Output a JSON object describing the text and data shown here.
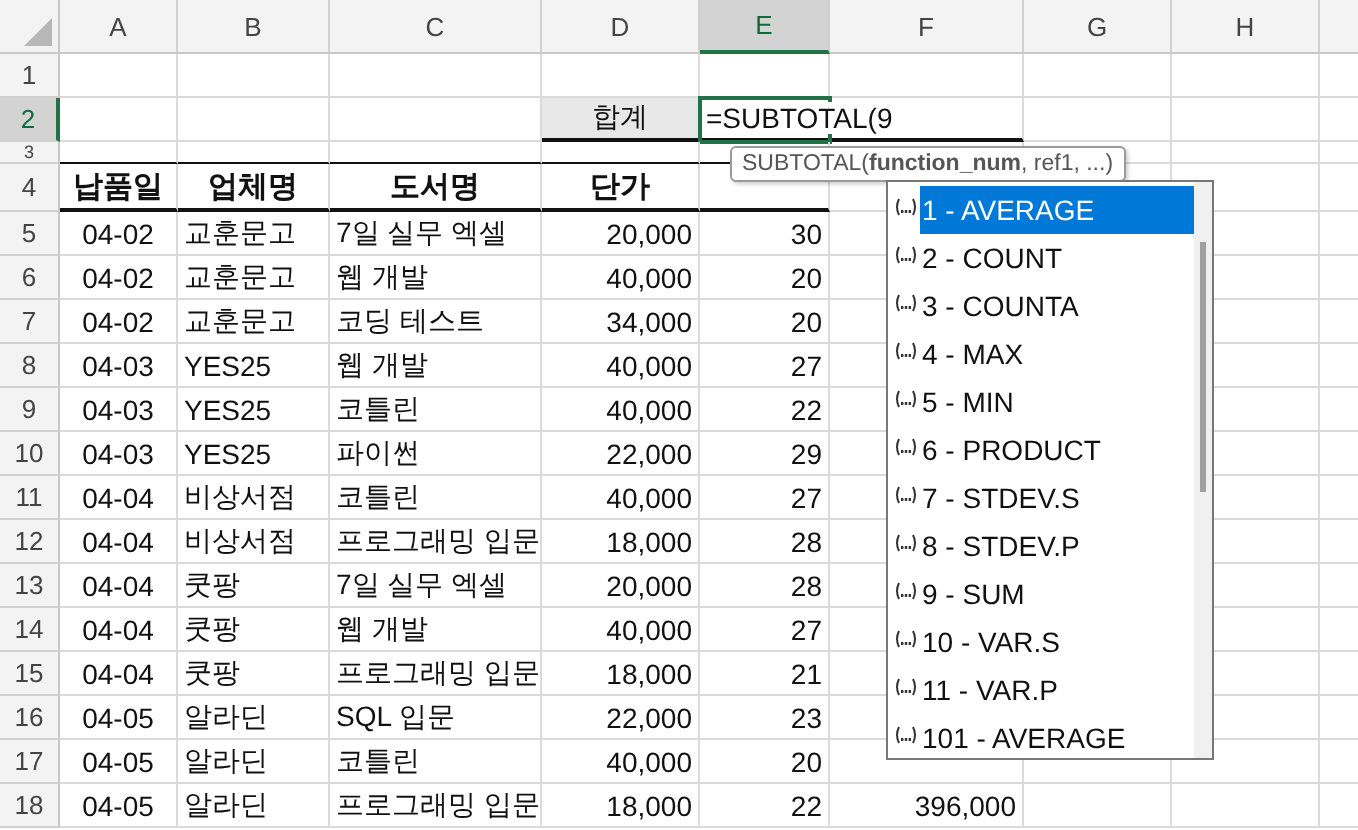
{
  "columns": [
    {
      "label": "A",
      "selected": false
    },
    {
      "label": "B",
      "selected": false
    },
    {
      "label": "C",
      "selected": false
    },
    {
      "label": "D",
      "selected": false
    },
    {
      "label": "E",
      "selected": true
    },
    {
      "label": "F",
      "selected": false
    },
    {
      "label": "G",
      "selected": false
    },
    {
      "label": "H",
      "selected": false
    }
  ],
  "rows": [
    {
      "label": "1",
      "selected": false
    },
    {
      "label": "2",
      "selected": true
    },
    {
      "label": "3",
      "selected": false
    },
    {
      "label": "4",
      "selected": false
    },
    {
      "label": "5",
      "selected": false
    },
    {
      "label": "6",
      "selected": false
    },
    {
      "label": "7",
      "selected": false
    },
    {
      "label": "8",
      "selected": false
    },
    {
      "label": "9",
      "selected": false
    },
    {
      "label": "10",
      "selected": false
    },
    {
      "label": "11",
      "selected": false
    },
    {
      "label": "12",
      "selected": false
    },
    {
      "label": "13",
      "selected": false
    },
    {
      "label": "14",
      "selected": false
    },
    {
      "label": "15",
      "selected": false
    },
    {
      "label": "16",
      "selected": false
    },
    {
      "label": "17",
      "selected": false
    },
    {
      "label": "18",
      "selected": false
    }
  ],
  "summary": {
    "label": "합계",
    "formula": "=SUBTOTAL(9"
  },
  "headers": [
    "납품일",
    "업체명",
    "도서명",
    "단가"
  ],
  "records": [
    [
      "04-02",
      "교훈문고",
      "7일 실무 엑셀",
      "20,000",
      "30"
    ],
    [
      "04-02",
      "교훈문고",
      "웹 개발",
      "40,000",
      "20"
    ],
    [
      "04-02",
      "교훈문고",
      "코딩 테스트",
      "34,000",
      "20"
    ],
    [
      "04-03",
      "YES25",
      "웹 개발",
      "40,000",
      "27"
    ],
    [
      "04-03",
      "YES25",
      "코틀린",
      "40,000",
      "22"
    ],
    [
      "04-03",
      "YES25",
      "파이썬",
      "22,000",
      "29"
    ],
    [
      "04-04",
      "비상서점",
      "코틀린",
      "40,000",
      "27"
    ],
    [
      "04-04",
      "비상서점",
      "프로그래밍 입문",
      "18,000",
      "28"
    ],
    [
      "04-04",
      "쿳팡",
      "7일 실무 엑셀",
      "20,000",
      "28"
    ],
    [
      "04-04",
      "쿳팡",
      "웹 개발",
      "40,000",
      "27"
    ],
    [
      "04-04",
      "쿳팡",
      "프로그래밍 입문",
      "18,000",
      "21"
    ],
    [
      "04-05",
      "알라딘",
      "SQL 입문",
      "22,000",
      "23"
    ],
    [
      "04-05",
      "알라딘",
      "코틀린",
      "40,000",
      "20"
    ],
    [
      "04-05",
      "알라딘",
      "프로그래밍 입문",
      "18,000",
      "22",
      "396,000"
    ]
  ],
  "tooltip": "SUBTOTAL(**function_num**, ref1, ...)",
  "autocomplete": [
    {
      "label": "1 - AVERAGE",
      "selected": true
    },
    {
      "label": "2 - COUNT",
      "selected": false
    },
    {
      "label": "3 - COUNTA",
      "selected": false
    },
    {
      "label": "4 - MAX",
      "selected": false
    },
    {
      "label": "5 - MIN",
      "selected": false
    },
    {
      "label": "6 - PRODUCT",
      "selected": false
    },
    {
      "label": "7 - STDEV.S",
      "selected": false
    },
    {
      "label": "8 - STDEV.P",
      "selected": false
    },
    {
      "label": "9 - SUM",
      "selected": false
    },
    {
      "label": "10 - VAR.S",
      "selected": false
    },
    {
      "label": "11 - VAR.P",
      "selected": false
    },
    {
      "label": "101 - AVERAGE",
      "selected": false
    }
  ]
}
